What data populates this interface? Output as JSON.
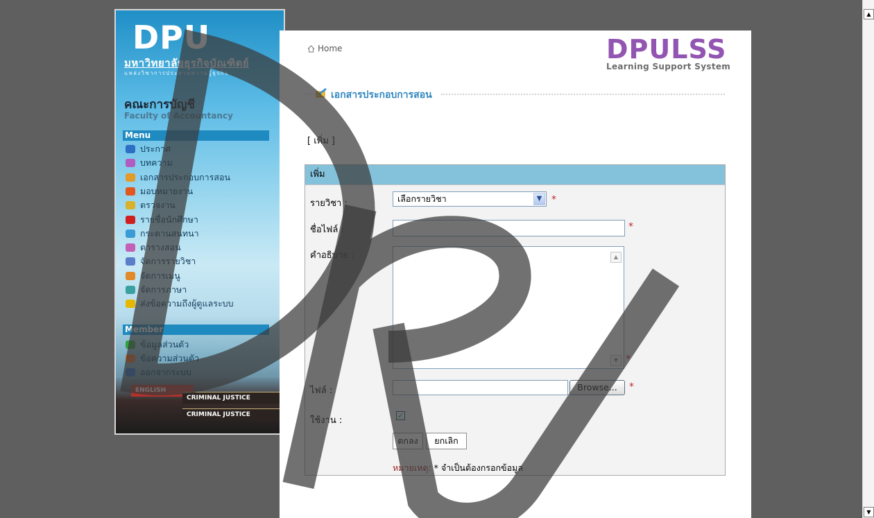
{
  "banner": {
    "logo": "DPU",
    "university_name": "มหาวิทยาลัยธุรกิจบัณฑิตย์",
    "tagline": "แหล่งวิชาการประสานความรู้ธุรกิจ",
    "faculty_th": "คณะการบัญชี",
    "faculty_en": "Faculty of Accountancy",
    "menu_title": "Menu",
    "menu_items": [
      {
        "label": "ประกาศ",
        "icon": "announcement-icon",
        "color": "#2c6fc4"
      },
      {
        "label": "บทความ",
        "icon": "article-icon",
        "color": "#b05cc0"
      },
      {
        "label": "เอกสารประกอบการสอน",
        "icon": "document-icon",
        "color": "#e49b2a"
      },
      {
        "label": "มอบหมายงาน",
        "icon": "assignment-icon",
        "color": "#e2571f"
      },
      {
        "label": "ตรวจงาน",
        "icon": "check-work-icon",
        "color": "#d9b12a"
      },
      {
        "label": "รายชื่อนักศึกษา",
        "icon": "student-list-icon",
        "color": "#cf1f1f"
      },
      {
        "label": "กระดานสนทนา",
        "icon": "forum-icon",
        "color": "#3a9bd6"
      },
      {
        "label": "ตารางสอน",
        "icon": "schedule-icon",
        "color": "#c45fb8"
      },
      {
        "label": "จัดการรายวิชา",
        "icon": "manage-course-icon",
        "color": "#5a7fc8"
      },
      {
        "label": "จัดการเมนู",
        "icon": "manage-menu-icon",
        "color": "#e08a2a"
      },
      {
        "label": "จัดการภาษา",
        "icon": "manage-language-icon",
        "color": "#3aa0a0"
      },
      {
        "label": "ส่งข้อความถึงผู้ดูแลระบบ",
        "icon": "message-admin-icon",
        "color": "#e6b800"
      }
    ],
    "member_title": "Member",
    "member_items": [
      {
        "label": "ข้อมูลส่วนตัว",
        "icon": "profile-icon",
        "color": "#2fa33f"
      },
      {
        "label": "ข้อความส่วนตัว",
        "icon": "private-message-icon",
        "color": "#e0702a"
      },
      {
        "label": "ออกจากระบบ",
        "icon": "logout-icon",
        "color": "#2f6fc4"
      }
    ],
    "books": [
      "ENGLISH",
      "CRIMINAL JUSTICE",
      "CRIMINAL JUSTICE"
    ]
  },
  "header": {
    "home_label": "Home",
    "lss_logo": "DPULSS",
    "lss_subtitle": "Learning Support System"
  },
  "section": {
    "title": "เอกสารประกอบการสอน",
    "add_link": "[ เพิ่ม ]"
  },
  "form": {
    "header": "เพิ่ม",
    "course_label": "รายวิชา :",
    "course_selected": "เลือกรายวิชา",
    "filename_label": "ชื่อไฟล์ :",
    "filename_value": "",
    "description_label": "คำอธิบาย :",
    "description_value": "",
    "file_label": "ไฟล์ :",
    "browse_label": "Browse...",
    "active_label": "ใช้งาน :",
    "active_checked": true,
    "submit_label": "ตกลง",
    "cancel_label": "ยกเลิก",
    "required_mark": "*",
    "note_label": "หมายเหตุ:",
    "note_text": "* จำเป็นต้องกรอกข้อมูล"
  },
  "watermark": "DPU",
  "colors": {
    "background": "#5f5f5f",
    "accent_blue": "#84c2dc",
    "required_red": "#c0262d",
    "lss_purple": "#9255b2"
  }
}
